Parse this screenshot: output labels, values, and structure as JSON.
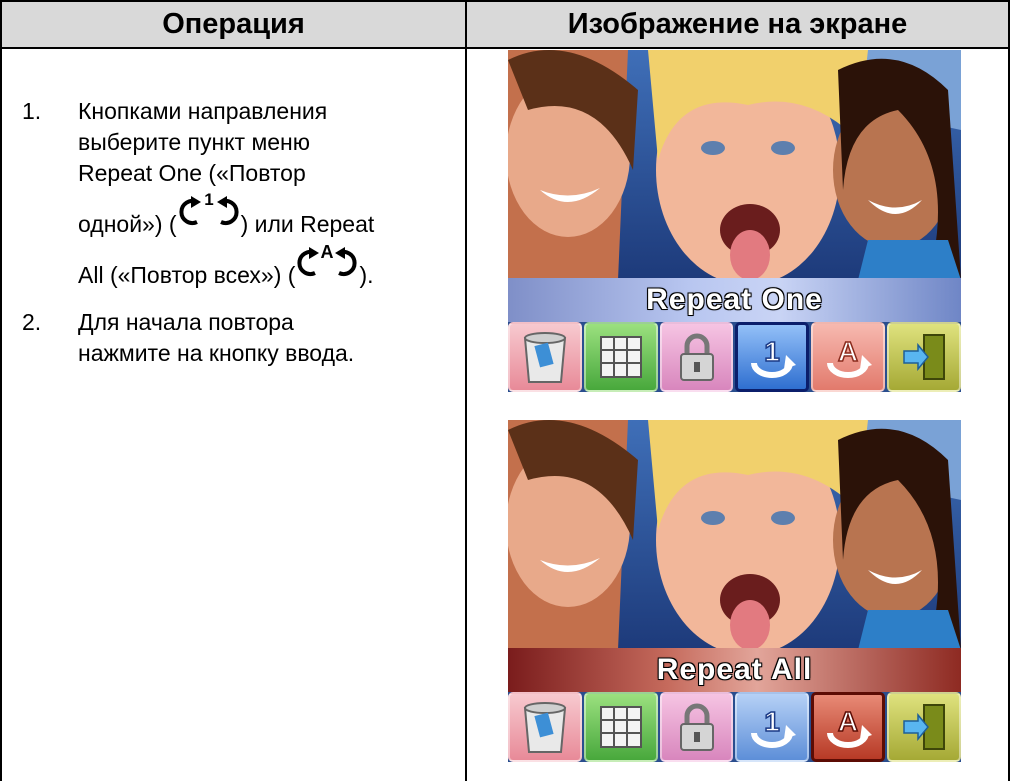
{
  "table": {
    "header": {
      "operation": "Операция",
      "screen": "Изображение на экране"
    },
    "steps": [
      {
        "number": "1.",
        "lines": [
          "Кнопками направления",
          "выберите пункт меню",
          "Repeat One («Повтор",
          "одной») (",
          ") или Repeat",
          "All («Повтор всех») (",
          ")."
        ]
      },
      {
        "number": "2.",
        "lines": [
          "Для начала повтора",
          "нажмите на кнопку ввода."
        ]
      }
    ]
  },
  "screens": [
    {
      "banner": "Repeat One",
      "selected": "repeat-one",
      "icons": [
        "trash-icon",
        "thumbnail-grid-icon",
        "lock-icon",
        "repeat-one-icon",
        "repeat-all-icon",
        "exit-icon"
      ]
    },
    {
      "banner": "Repeat All",
      "selected": "repeat-all",
      "icons": [
        "trash-icon",
        "thumbnail-grid-icon",
        "lock-icon",
        "repeat-one-icon",
        "repeat-all-icon",
        "exit-icon"
      ]
    }
  ],
  "inline_icons": {
    "repeat_one_glyph": "1",
    "repeat_all_glyph": "A"
  },
  "colors": {
    "header_bg": "#d9d9d9",
    "repeat_one_banner": "#b8c6f0",
    "repeat_all_banner": "#c56a5c"
  }
}
